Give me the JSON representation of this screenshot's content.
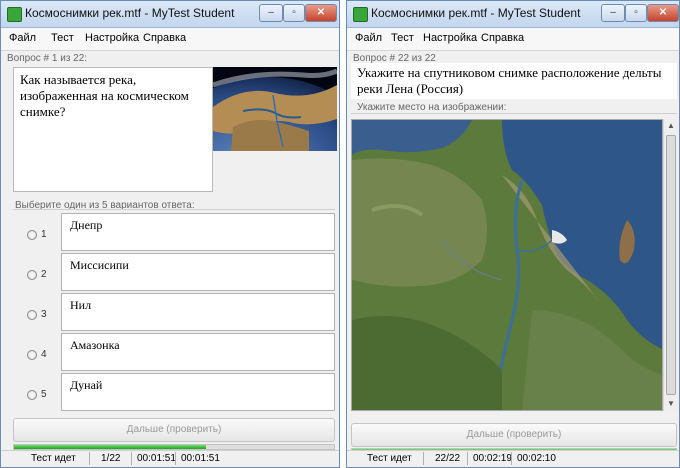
{
  "left_window": {
    "title": "Космоснимки рек.mtf - MyTest Student",
    "menu": [
      "Файл",
      "Тест",
      "Настройка",
      "Справка"
    ],
    "question_header": "Вопрос # 1 из 22:",
    "question_text": "Как называется река, изображенная на космическом снимке?",
    "choose_label": "Выберите один из 5 вариантов ответа:",
    "options": [
      {
        "num": "1",
        "text": "Днепр"
      },
      {
        "num": "2",
        "text": "Миссисипи"
      },
      {
        "num": "3",
        "text": "Нил"
      },
      {
        "num": "4",
        "text": "Амазонка"
      },
      {
        "num": "5",
        "text": "Дунай"
      }
    ],
    "next_button": "Дальше (проверить)",
    "progress": 0.6,
    "status": {
      "state": "Тест идет",
      "count": "1/22",
      "time1": "00:01:51",
      "time2": "00:01:51"
    }
  },
  "right_window": {
    "title": "Космоснимки рек.mtf - MyTest Student",
    "menu": [
      "Файл",
      "Тест",
      "Настройка",
      "Справка"
    ],
    "question_header": "Вопрос # 22 из 22",
    "question_text": "Укажите на спутниковом снимке расположение дельты реки Лена (Россия)",
    "image_label": "Укажите место на изображении:",
    "next_button": "Дальше (проверить)",
    "progress": 1.0,
    "status": {
      "state": "Тест идет",
      "count": "22/22",
      "time1": "00:02:19",
      "time2": "00:02:10"
    }
  },
  "window_buttons": {
    "minimize": "–",
    "maximize": "▫",
    "close": "✕"
  },
  "colors": {
    "progress_fill": "#1fa31f",
    "close_button": "#c4432c"
  }
}
